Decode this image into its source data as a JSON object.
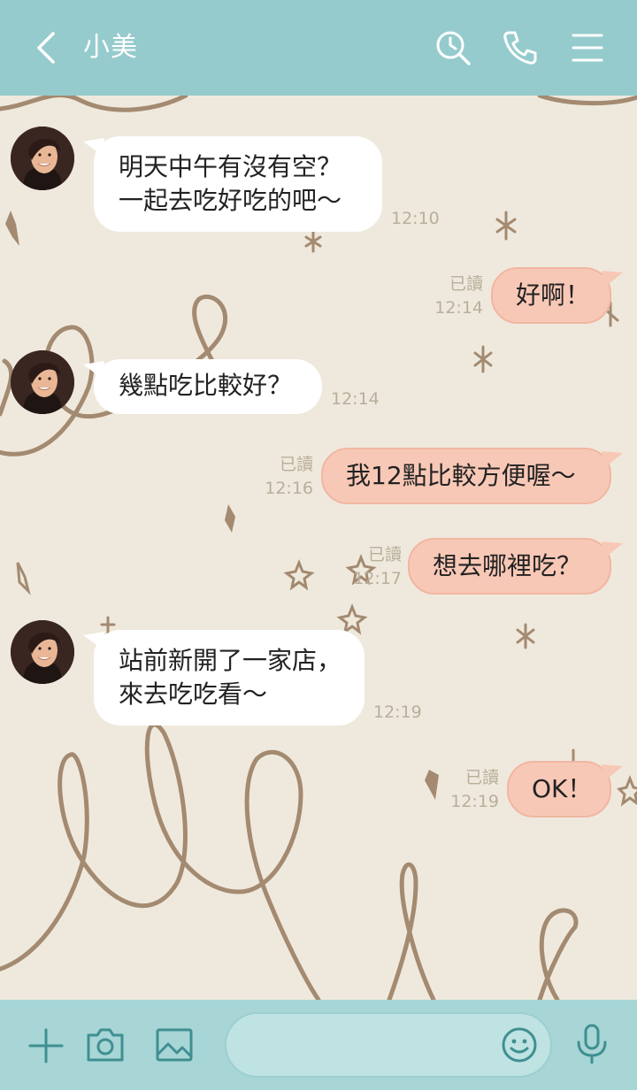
{
  "header": {
    "title": "小美",
    "back_icon": "chevron-left-icon",
    "search_icon": "search-icon",
    "call_icon": "phone-icon",
    "menu_icon": "menu-icon",
    "bg_color": "#95cbcd"
  },
  "messages": [
    {
      "dir": "in",
      "lines": [
        "明天中午有沒有空？",
        "一起去吃好吃的吧～"
      ],
      "time": "12:10"
    },
    {
      "dir": "out",
      "lines": [
        "好啊！"
      ],
      "read": "已讀",
      "time": "12:14"
    },
    {
      "dir": "in",
      "lines": [
        "幾點吃比較好？"
      ],
      "time": "12:14"
    },
    {
      "dir": "out",
      "lines": [
        "我12點比較方便喔～"
      ],
      "read": "已讀",
      "time": "12:16"
    },
    {
      "dir": "out",
      "lines": [
        "想去哪裡吃？"
      ],
      "read": "已讀",
      "time": "12:17"
    },
    {
      "dir": "in",
      "lines": [
        "站前新開了一家店，",
        "來去吃吃看～"
      ],
      "time": "12:19"
    },
    {
      "dir": "out",
      "lines": [
        "OK！"
      ],
      "read": "已讀",
      "time": "12:19"
    }
  ],
  "footer": {
    "plus_icon": "plus-icon",
    "camera_icon": "camera-icon",
    "image_icon": "image-icon",
    "input_placeholder": "",
    "emoji_icon": "emoji-icon",
    "mic_icon": "microphone-icon"
  },
  "colors": {
    "background": "#efe9dd",
    "incoming_bubble": "#ffffff",
    "outgoing_bubble": "#f8c8b6",
    "doodle": "#a38a70",
    "footer": "#a8d5d6"
  }
}
